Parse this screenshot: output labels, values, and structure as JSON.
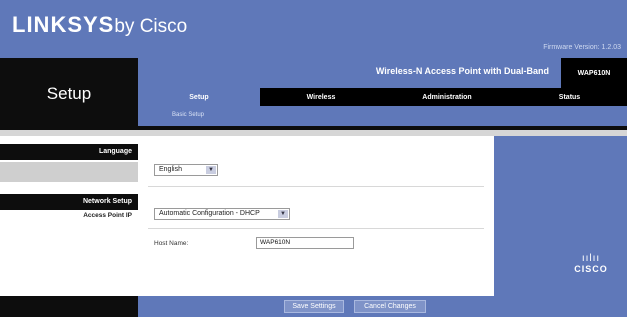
{
  "brand": {
    "logo_main": "LINKSYS",
    "logo_suffix": "by Cisco",
    "firmware": "Firmware Version: 1.2.03"
  },
  "section": {
    "title": "Setup"
  },
  "product": {
    "name": "Wireless-N Access Point with Dual-Band",
    "model": "WAP610N"
  },
  "tabs": [
    {
      "label": "Setup",
      "active": true
    },
    {
      "label": "Wireless",
      "active": false
    },
    {
      "label": "Administration",
      "active": false
    },
    {
      "label": "Status",
      "active": false
    }
  ],
  "subtab": {
    "label": "Basic Setup"
  },
  "leftnav": {
    "language_heading": "Language",
    "network_heading": "Network Setup",
    "access_point_ip": "Access Point IP"
  },
  "form": {
    "language_value": "English",
    "ip_mode_value": "Automatic Configuration - DHCP",
    "host_name_label": "Host Name:",
    "host_name_value": "WAP610N"
  },
  "buttons": {
    "save": "Save Settings",
    "cancel": "Cancel Changes"
  },
  "footer": {
    "brand": "CISCO"
  },
  "colors": {
    "blue": "#5f78b9",
    "black": "#0d0d0d"
  }
}
